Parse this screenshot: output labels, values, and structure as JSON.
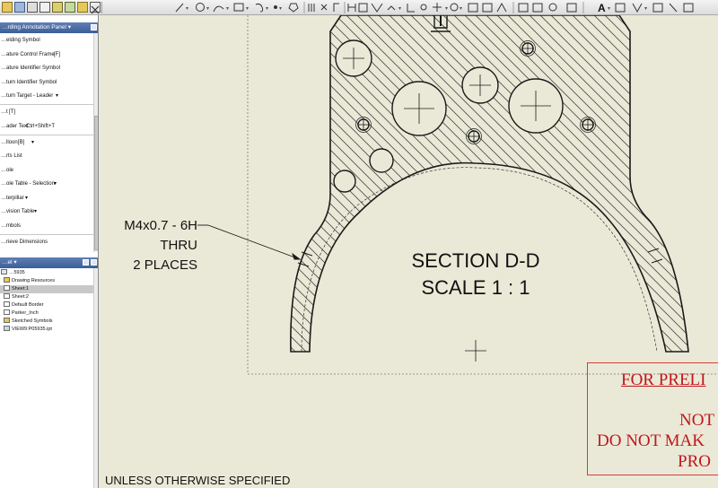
{
  "toolbar": {
    "text_tool_label": "A"
  },
  "annotation_panel": {
    "title": "…rding Annotation Panel ▾",
    "items": [
      {
        "label": "…elding Symbol",
        "shortcut": "",
        "dropdown": false
      },
      {
        "label": "…ature Control Frame",
        "shortcut": "[F]",
        "dropdown": false
      },
      {
        "label": "…ature Identifier Symbol",
        "shortcut": "",
        "dropdown": false
      },
      {
        "label": "…tum Identifier Symbol",
        "shortcut": "",
        "dropdown": false
      },
      {
        "label": "…tum Target - Leader",
        "shortcut": "",
        "dropdown": true
      },
      {
        "label": "…t",
        "shortcut": "[T]",
        "dropdown": false
      },
      {
        "label": "…ader Text",
        "shortcut": "Ctrl+Shift+T",
        "dropdown": false
      },
      {
        "label": "…lloon",
        "shortcut": "[B]",
        "dropdown": true
      },
      {
        "label": "…rts List",
        "shortcut": "",
        "dropdown": false
      },
      {
        "label": "…ole",
        "shortcut": "",
        "dropdown": false
      },
      {
        "label": "…ole Table - Selection",
        "shortcut": "",
        "dropdown": true
      },
      {
        "label": "…terpillar",
        "shortcut": "",
        "dropdown": true
      },
      {
        "label": "…vision Table",
        "shortcut": "",
        "dropdown": true
      },
      {
        "label": "…mbols",
        "shortcut": "",
        "dropdown": false
      },
      {
        "label": "…rieve Dimensions",
        "shortcut": "",
        "dropdown": false
      }
    ]
  },
  "browser_panel": {
    "title": "…el ▾",
    "root": "…5935",
    "items": [
      {
        "label": "Drawing Resources",
        "selected": false
      },
      {
        "label": "Sheet:1",
        "selected": true
      },
      {
        "label": "Sheet:2",
        "selected": false
      },
      {
        "label": "Default Border",
        "selected": false
      },
      {
        "label": "Parker_Inch",
        "selected": false
      },
      {
        "label": "Sketched Symbols",
        "selected": false
      },
      {
        "label": "VIEW9:P05935.ipt",
        "selected": false
      }
    ]
  },
  "drawing": {
    "thread_note": [
      "M4x0.7 - 6H",
      "THRU",
      "2 PLACES"
    ],
    "section_title": "SECTION D-D",
    "section_scale": "SCALE 1 : 1",
    "prelim_stamp": [
      "FOR PRELI",
      "NOT",
      "DO NOT MAK",
      "PRO"
    ],
    "unless_note": "UNLESS OTHERWISE SPECIFIED"
  },
  "colors": {
    "canvas_bg": "#eae9d7",
    "stamp_red": "#c0161c",
    "panel_header": "#3a5e9a"
  }
}
